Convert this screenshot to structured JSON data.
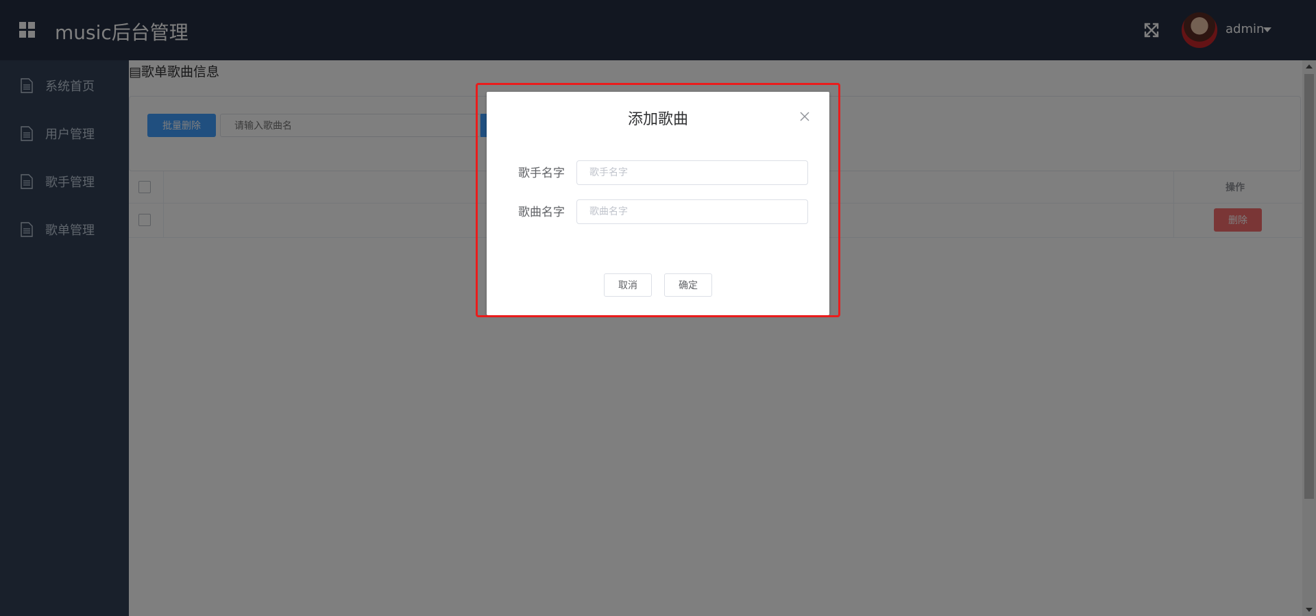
{
  "header": {
    "title": "music后台管理",
    "username": "admin"
  },
  "sidebar": {
    "items": [
      {
        "label": "系统首页"
      },
      {
        "label": "用户管理"
      },
      {
        "label": "歌手管理"
      },
      {
        "label": "歌单管理"
      }
    ]
  },
  "main": {
    "breadcrumb": "歌单歌曲信息",
    "toolbar": {
      "batch_delete_label": "批量删除",
      "search_placeholder": "请输入歌曲名"
    },
    "table": {
      "operation_header": "操作",
      "rows": [
        {
          "delete_label": "删除"
        }
      ]
    }
  },
  "dialog": {
    "title": "添加歌曲",
    "singer_label": "歌手名字",
    "singer_placeholder": "歌手名字",
    "song_label": "歌曲名字",
    "song_placeholder": "歌曲名字",
    "cancel_label": "取消",
    "confirm_label": "确定"
  },
  "colors": {
    "header_bg": "#242f42",
    "sidebar_bg": "#324157",
    "primary": "#409eff",
    "danger": "#f56c6c",
    "highlight_border": "#ea1c1c"
  }
}
